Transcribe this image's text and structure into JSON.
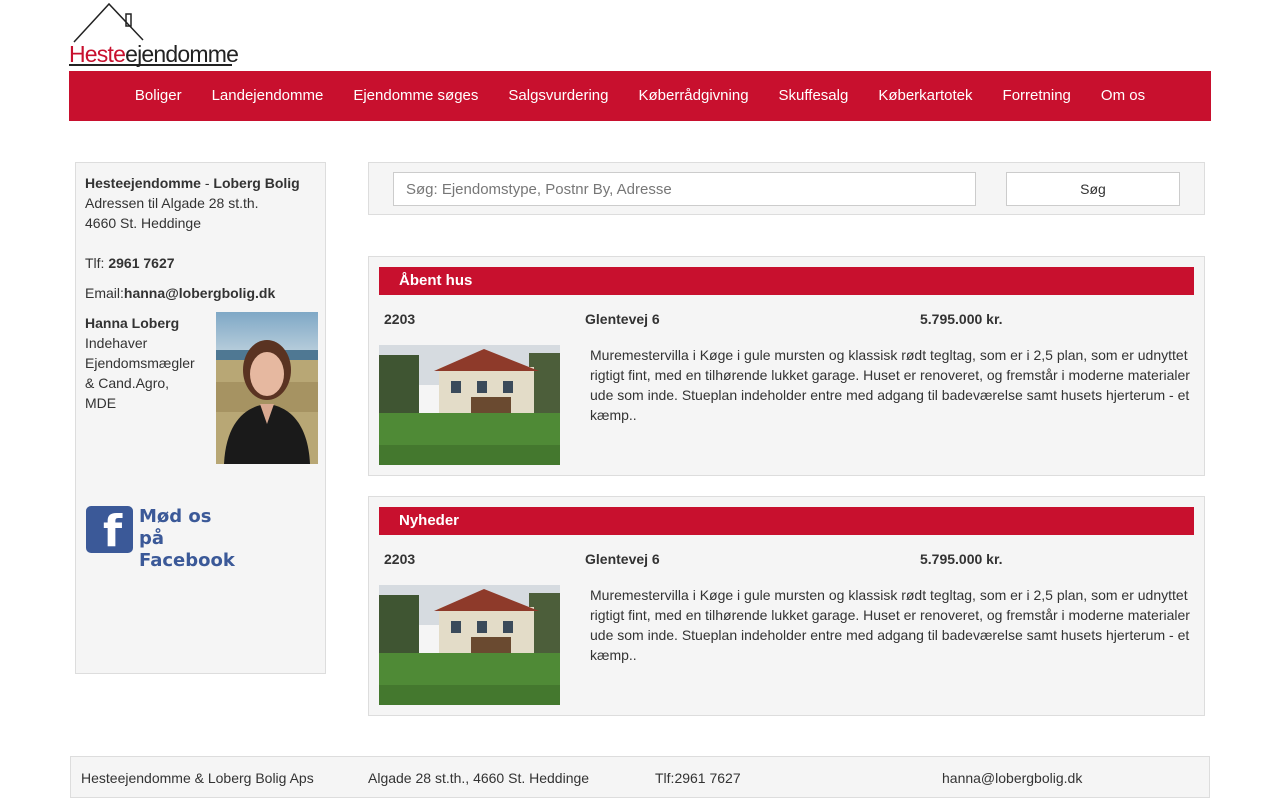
{
  "logo": {
    "part1": "Heste",
    "part2": "ejendomme"
  },
  "nav": {
    "items": [
      "Boliger",
      "Landejendomme",
      "Ejendomme søges",
      "Salgsvurdering",
      "Køberrådgivning",
      "Skuffesalg",
      "Køberkartotek",
      "Forretning",
      "Om os"
    ]
  },
  "sidebar": {
    "company_a": "Hesteejendomme",
    "dash": " - ",
    "company_b": "Loberg Bolig",
    "address1": "Adressen til Algade 28 st.th.",
    "address2": "4660 St. Heddinge",
    "phone_label": "Tlf: ",
    "phone": "2961 7627",
    "email_label": "Email:",
    "email": "hanna@lobergbolig.dk",
    "agent_name": "Hanna Loberg",
    "agent_title": "Indehaver Ejendomsmægler & Cand.Agro, MDE",
    "facebook_line1": "Mød os på",
    "facebook_line2": "Facebook"
  },
  "search": {
    "placeholder": "Søg: Ejendomstype, Postnr By, Adresse",
    "button_label": "Søg"
  },
  "open_house": {
    "title": "Åbent hus",
    "zip": "2203",
    "address": "Glentevej 6",
    "price": "5.795.000 kr.",
    "description": "Muremestervilla i Køge i gule mursten og klassisk rødt tegltag, som er i 2,5 plan, som er udnyttet rigtigt fint, med en tilhørende lukket garage. Huset er renoveret, og fremstår i moderne materialer ude som inde. Stueplan indeholder entre med adgang til badeværelse samt husets hjerterum - et kæmp.."
  },
  "news": {
    "title": "Nyheder",
    "zip": "2203",
    "address": "Glentevej 6",
    "price": "5.795.000 kr.",
    "description": "Muremestervilla i Køge i gule mursten og klassisk rødt tegltag, som er i 2,5 plan, som er udnyttet rigtigt fint, med en tilhørende lukket garage. Huset er renoveret, og fremstår i moderne materialer ude som inde. Stueplan indeholder entre med adgang til badeværelse samt husets hjerterum - et kæmp.."
  },
  "footer": {
    "company": "Hesteejendomme & Loberg Bolig Aps",
    "address": "Algade 28 st.th., 4660 St. Heddinge",
    "phone": "Tlf:2961 7627",
    "email": "hanna@lobergbolig.dk"
  },
  "colors": {
    "brand_red": "#c8102e",
    "panel_bg": "#f5f5f5",
    "facebook_blue": "#3b5998"
  },
  "icons": {
    "logo_roof": "house-roof-icon",
    "facebook": "facebook-icon"
  }
}
